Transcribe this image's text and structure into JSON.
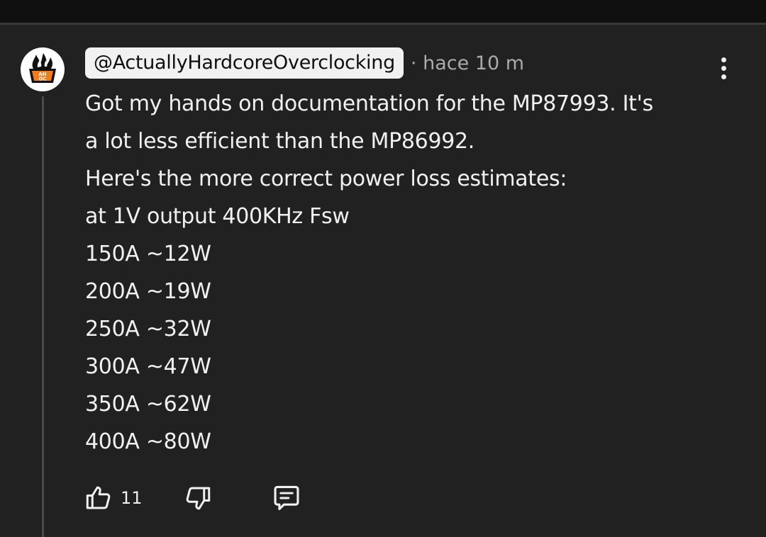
{
  "comment": {
    "handle": "@ActuallyHardcoreOverclocking",
    "separator": "·",
    "time": "hace 10 m",
    "avatar_icon": "flame-logo-icon",
    "avatar_text": "AH OC",
    "lines": [
      "Got my hands on documentation for the MP87993. It's",
      "a lot less efficient than the MP86992.",
      "Here's the more correct power loss estimates:",
      "at 1V output 400KHz Fsw",
      "150A ~12W",
      "200A ~19W",
      "250A ~32W",
      "300A ~47W",
      "350A ~62W",
      "400A ~80W"
    ],
    "actions": {
      "like_icon": "thumbs-up-icon",
      "like_count": "11",
      "dislike_icon": "thumbs-down-icon",
      "reply_icon": "comment-icon"
    },
    "menu_icon": "more-vert-icon"
  },
  "colors": {
    "background": "#212121",
    "top_bar": "#0f0f0f",
    "text": "#f1f1f1",
    "muted": "#aaaaaa",
    "avatar_orange": "#f07c1a"
  }
}
